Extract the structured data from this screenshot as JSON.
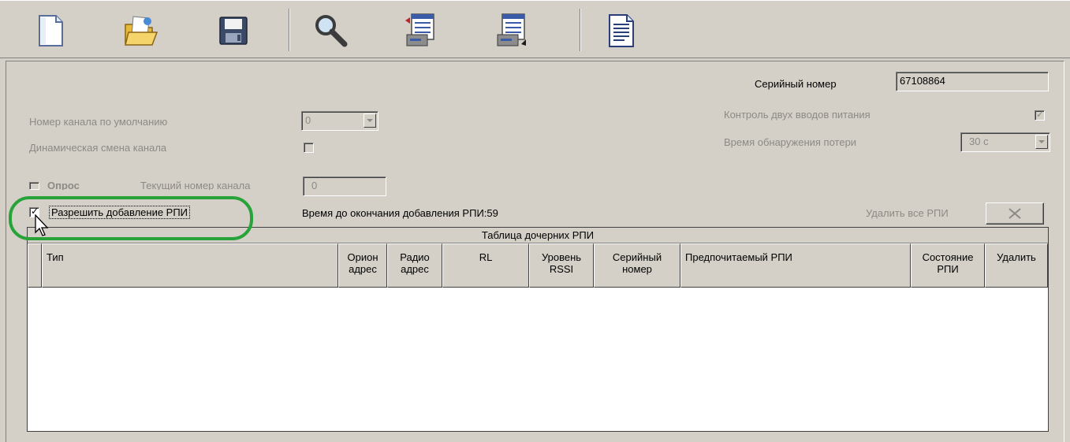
{
  "toolbar": {
    "buttons": [
      {
        "name": "new-document-icon"
      },
      {
        "name": "open-folder-icon"
      },
      {
        "name": "save-disk-icon"
      },
      {
        "name": "search-icon"
      },
      {
        "name": "read-config-icon"
      },
      {
        "name": "write-config-icon"
      },
      {
        "name": "report-document-icon"
      }
    ]
  },
  "serial": {
    "label": "Серийный номер",
    "value": "67108864"
  },
  "default_channel": {
    "label": "Номер канала по умолчанию",
    "value": "0"
  },
  "dynamic_channel": {
    "label": "Динамическая смена канала",
    "checked": false
  },
  "power_control": {
    "label": "Контроль двух вводов питания",
    "checked": true
  },
  "loss_detection": {
    "label": "Время обнаружения потери",
    "value": "30 с"
  },
  "polling": {
    "label": "Опрос",
    "checked": false,
    "current_channel_label": "Текущий номер канала",
    "current_channel_value": "0"
  },
  "allow_add": {
    "label": "Разрешить добавление РПИ",
    "checked": true
  },
  "timer_text": "Время до окончания добавления РПИ:59",
  "delete_all": {
    "label": "Удалить все РПИ",
    "icon": "close-x-icon"
  },
  "grid": {
    "caption": "Таблица дочерних РПИ",
    "columns": [
      {
        "line1": "Тип",
        "line2": ""
      },
      {
        "line1": "Орион",
        "line2": "адрес"
      },
      {
        "line1": "Радио",
        "line2": "адрес"
      },
      {
        "line1": "RL",
        "line2": ""
      },
      {
        "line1": "Уровень",
        "line2": "RSSI"
      },
      {
        "line1": "Серийный",
        "line2": "номер"
      },
      {
        "line1": "Предпочитаемый РПИ",
        "line2": ""
      },
      {
        "line1": "Состояние",
        "line2": "РПИ"
      },
      {
        "line1": "Удалить",
        "line2": ""
      }
    ],
    "rows": []
  },
  "colors": {
    "background": "#d4d0c8",
    "highlight": "#27a33a",
    "disabled_text": "#8c8a86"
  }
}
